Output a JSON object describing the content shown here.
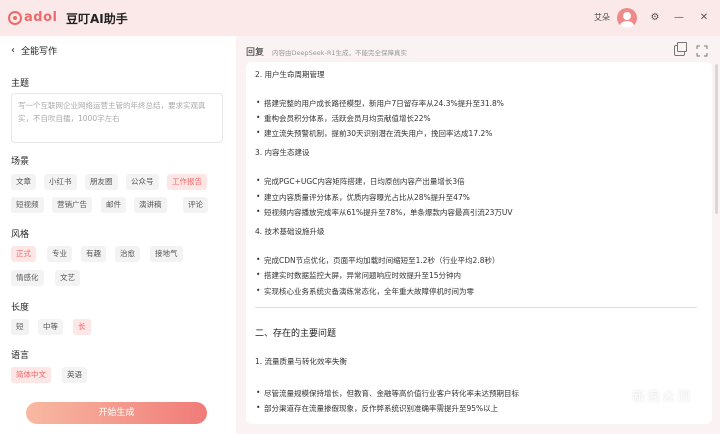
{
  "app": {
    "logo_text": "adol",
    "title": "豆叮AI助手",
    "user_name": "艾朵"
  },
  "left": {
    "back_label": "全能写作",
    "topic": {
      "label": "主题",
      "placeholder": "写一个互联网企业网络运营主管的年终总结，要求实观真实，不自吹自擂，1000字左右"
    },
    "scene": {
      "label": "场景",
      "options": [
        "文章",
        "小红书",
        "朋友圈",
        "公众号",
        "工作报告",
        "短视频",
        "营销广告",
        "邮件",
        "演讲稿",
        "评论"
      ],
      "selected": "工作报告"
    },
    "style": {
      "label": "风格",
      "options": [
        "正式",
        "专业",
        "有趣",
        "治愈",
        "接地气",
        "情感化",
        "文艺"
      ],
      "selected": "正式"
    },
    "length": {
      "label": "长度",
      "options": [
        "短",
        "中等",
        "长"
      ],
      "selected": "长"
    },
    "language": {
      "label": "语言",
      "options": [
        "简体中文",
        "英语"
      ],
      "selected": "简体中文"
    },
    "start_button": "开始生成"
  },
  "right": {
    "reply_label": "回复",
    "reply_note": "内容由DeepSeek-R1生成，不能完全保障真实",
    "lines": [
      "2. 用户生命周期管理",
      "搭建完整的用户成长路径模型，新用户7日留存率从24.3%提升至31.8%",
      "重构会员积分体系，活跃会员月均贡献值增长22%",
      "建立流失预警机制，提前30天识别潜在流失用户，挽回率达成17.2%",
      "3. 内容生态建设",
      "完成PGC+UGC内容矩阵搭建，日均原创内容产出量增长3倍",
      "建立内容质量评分体系，优质内容曝光占比从28%提升至47%",
      "短视频内容播放完成率从61%提升至78%，单条爆款内容最高引流23万UV",
      "4. 技术基础设施升级",
      "完成CDN节点优化，页面平均加载时间缩短至1.2秒（行业平均2.8秒）",
      "搭建实时数据监控大屏，异常问题响应时效提升至15分钟内",
      "实现核心业务系统灾备演练常态化，全年重大故障停机时间为零",
      "二、存在的主要问题",
      "1. 流量质量与转化效率失衡",
      "尽管流量规模保持增长，但教育、金融等高价值行业客户转化率未达预期目标",
      "部分渠道存在流量掺假现象，反作弊系统识别准确率需提升至95%以上"
    ]
  },
  "watermark": "新浪众测"
}
